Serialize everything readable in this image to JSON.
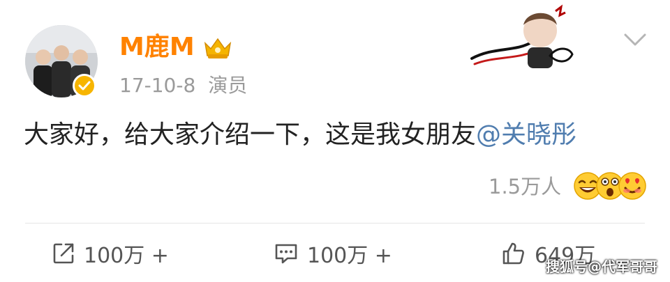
{
  "post": {
    "username": "M鹿M",
    "date": "17-10-8",
    "source": "演员",
    "text_main": "大家好，给大家介绍一下，这是我女朋友",
    "mention": "@关晓彤",
    "likes_count": "1.5万人"
  },
  "actions": {
    "repost": "100万 +",
    "comment": "100万 +",
    "like": "649万"
  },
  "watermark": "搜狐号@代军哥哥",
  "colors": {
    "username": "#ff8200",
    "mention": "#507daf",
    "meta": "#9a9a9a",
    "verified_badge": "#f7b500"
  },
  "icons": {
    "avatar": "group-photo",
    "verified": "verified-badge-icon",
    "crown": "crown-vip-icon",
    "chevron": "chevron-down-icon",
    "repost": "repost-icon",
    "comment": "comment-icon",
    "like": "thumbs-up-icon",
    "reaction_emojis": [
      "laugh-emoji-icon",
      "shock-emoji-icon",
      "heart-eyes-emoji-icon"
    ]
  }
}
